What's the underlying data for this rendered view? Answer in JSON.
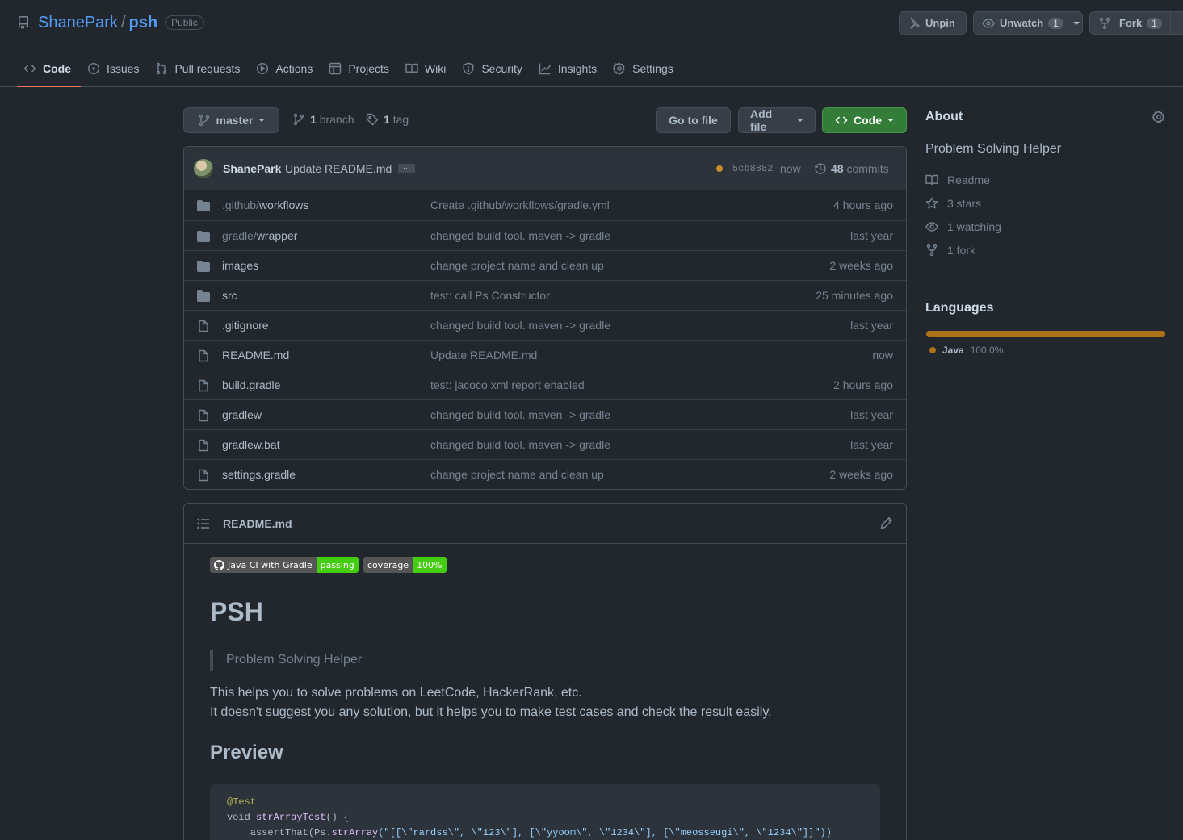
{
  "repo": {
    "owner": "ShanePark",
    "name": "psh",
    "visibility": "Public"
  },
  "header_actions": {
    "unpin": "Unpin",
    "unwatch": "Unwatch",
    "watch_count": "1",
    "fork": "Fork",
    "fork_count": "1"
  },
  "tabs": [
    {
      "label": "Code",
      "selected": true
    },
    {
      "label": "Issues"
    },
    {
      "label": "Pull requests"
    },
    {
      "label": "Actions"
    },
    {
      "label": "Projects"
    },
    {
      "label": "Wiki"
    },
    {
      "label": "Security"
    },
    {
      "label": "Insights"
    },
    {
      "label": "Settings"
    }
  ],
  "toolbar": {
    "branch": "master",
    "branch_count": "1",
    "branch_label": "branch",
    "tag_count": "1",
    "tag_label": "tag",
    "go_to_file": "Go to file",
    "add_file": "Add file",
    "code": "Code"
  },
  "latest_commit": {
    "author": "ShanePark",
    "message": "Update README.md",
    "ellipsis": "…",
    "sha": "5cb8882",
    "time": "now",
    "commit_count": "48",
    "commit_label": "commits"
  },
  "files": [
    {
      "type": "dir",
      "prefix": ".github/",
      "name": "workflows",
      "message": "Create .github/workflows/gradle.yml",
      "age": "4 hours ago"
    },
    {
      "type": "dir",
      "prefix": "gradle/",
      "name": "wrapper",
      "message": "changed build tool. maven -> gradle",
      "age": "last year"
    },
    {
      "type": "dir",
      "prefix": "",
      "name": "images",
      "message": "change project name and clean up",
      "age": "2 weeks ago"
    },
    {
      "type": "dir",
      "prefix": "",
      "name": "src",
      "message": "test: call Ps Constructor",
      "age": "25 minutes ago"
    },
    {
      "type": "file",
      "prefix": "",
      "name": ".gitignore",
      "message": "changed build tool. maven -> gradle",
      "age": "last year"
    },
    {
      "type": "file",
      "prefix": "",
      "name": "README.md",
      "message": "Update README.md",
      "age": "now"
    },
    {
      "type": "file",
      "prefix": "",
      "name": "build.gradle",
      "message": "test: jacoco xml report enabled",
      "age": "2 hours ago"
    },
    {
      "type": "file",
      "prefix": "",
      "name": "gradlew",
      "message": "changed build tool. maven -> gradle",
      "age": "last year"
    },
    {
      "type": "file",
      "prefix": "",
      "name": "gradlew.bat",
      "message": "changed build tool. maven -> gradle",
      "age": "last year"
    },
    {
      "type": "file",
      "prefix": "",
      "name": "settings.gradle",
      "message": "change project name and clean up",
      "age": "2 weeks ago"
    }
  ],
  "readme": {
    "title": "README.md",
    "badge1_left": "Java CI with Gradle",
    "badge1_right": "passing",
    "badge2_left": "coverage",
    "badge2_right": "100%",
    "heading": "PSH",
    "quote": "Problem Solving Helper",
    "para_line1": "This helps you to solve problems on LeetCode, HackerRank, etc.",
    "para_line2": "It doesn't suggest you any solution, but it helps you to make test cases and check the result easily.",
    "preview_heading": "Preview",
    "code_line1": "@Test",
    "code_line2_kw": "void ",
    "code_line2_fn": "strArrayTest",
    "code_line2_rest": "() {",
    "code_line3_a": "    assertThat(Ps.",
    "code_line3_fn": "strArray",
    "code_line3_str": "(\"[[\\\"rardss\\\", \\\"123\\\"], [\\\"yyoom\\\", \\\"1234\\\"], [\\\"meosseugi\\\", \\\"1234\\\"]]\"))"
  },
  "about": {
    "title": "About",
    "description": "Problem Solving Helper",
    "readme": "Readme",
    "stars": "3 stars",
    "watching": "1 watching",
    "forks": "1 fork"
  },
  "languages": {
    "title": "Languages",
    "items": [
      {
        "name": "Java",
        "percent": "100.0%",
        "color": "#b07219",
        "fraction": 1.0
      }
    ]
  },
  "colors": {
    "accent": "#539bf5",
    "primary_button": "#347d39",
    "tab_underline": "#ec775c",
    "status_pending": "#c69026"
  }
}
